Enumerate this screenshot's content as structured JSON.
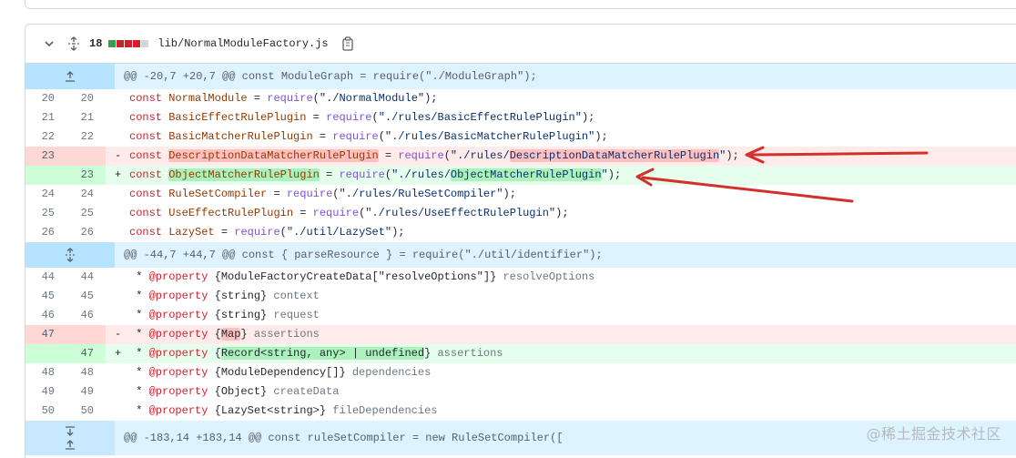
{
  "file": {
    "change_count": "18",
    "stat_colors": [
      "#2da44e",
      "#cf222e",
      "#cf222e",
      "#cf222e",
      "#d0d7de"
    ],
    "path": "lib/NormalModuleFactory.js",
    "icons": {
      "collapse": "chevron-down-icon",
      "expand": "unfold-icon",
      "copy": "copy-icon"
    }
  },
  "hunks": [
    {
      "header": "@@ -20,7 +20,7 @@ const ModuleGraph = require(\"./ModuleGraph\");"
    },
    {
      "header": "@@ -44,7 +44,7 @@ const { parseResource } = require(\"./util/identifier\");"
    },
    {
      "header": "@@ -183,14 +183,14 @@ const ruleSetCompiler = new RuleSetCompiler(["
    }
  ],
  "lines": [
    {
      "old": "20",
      "new": "20",
      "sign": " ",
      "text": "const NormalModule = require(\"./NormalModule\");"
    },
    {
      "old": "21",
      "new": "21",
      "sign": " ",
      "text": "const BasicEffectRulePlugin = require(\"./rules/BasicEffectRulePlugin\");"
    },
    {
      "old": "22",
      "new": "22",
      "sign": " ",
      "text": "const BasicMatcherRulePlugin = require(\"./rules/BasicMatcherRulePlugin\");"
    },
    {
      "old": "23",
      "new": "",
      "sign": "-",
      "text": "const DescriptionDataMatcherRulePlugin = require(\"./rules/DescriptionDataMatcherRulePlugin\");"
    },
    {
      "old": "",
      "new": "23",
      "sign": "+",
      "text": "const ObjectMatcherRulePlugin = require(\"./rules/ObjectMatcherRulePlugin\");"
    },
    {
      "old": "24",
      "new": "24",
      "sign": " ",
      "text": "const RuleSetCompiler = require(\"./rules/RuleSetCompiler\");"
    },
    {
      "old": "25",
      "new": "25",
      "sign": " ",
      "text": "const UseEffectRulePlugin = require(\"./rules/UseEffectRulePlugin\");"
    },
    {
      "old": "26",
      "new": "26",
      "sign": " ",
      "text": "const LazySet = require(\"./util/LazySet\");"
    },
    {
      "old": "44",
      "new": "44",
      "sign": " ",
      "text": " * @property {ModuleFactoryCreateData[\"resolveOptions\"]} resolveOptions"
    },
    {
      "old": "45",
      "new": "45",
      "sign": " ",
      "text": " * @property {string} context"
    },
    {
      "old": "46",
      "new": "46",
      "sign": " ",
      "text": " * @property {string} request"
    },
    {
      "old": "47",
      "new": "",
      "sign": "-",
      "text": " * @property {Map} assertions"
    },
    {
      "old": "",
      "new": "47",
      "sign": "+",
      "text": " * @property {Record<string, any> | undefined} assertions"
    },
    {
      "old": "48",
      "new": "48",
      "sign": " ",
      "text": " * @property {ModuleDependency[]} dependencies"
    },
    {
      "old": "49",
      "new": "49",
      "sign": " ",
      "text": " * @property {Object} createData"
    },
    {
      "old": "50",
      "new": "50",
      "sign": " ",
      "text": " * @property {LazySet<string>} fileDependencies"
    }
  ],
  "code_tokens": {
    "l0": {
      "kw": "const",
      "name": "NormalModule",
      "eq": " = ",
      "fn": "require",
      "p1": "(",
      "str": "\"./NormalModule\"",
      "p2": ");"
    },
    "l1": {
      "kw": "const",
      "name": "BasicEffectRulePlugin",
      "eq": " = ",
      "fn": "require",
      "p1": "(",
      "str": "\"./rules/BasicEffectRulePlugin\"",
      "p2": ");"
    },
    "l2": {
      "kw": "const",
      "name": "BasicMatcherRulePlugin",
      "eq": " = ",
      "fn": "require",
      "p1": "(",
      "str": "\"./rules/BasicMatcherRulePlugin\"",
      "p2": ");"
    },
    "l3": {
      "kw": "const",
      "name": "DescriptionDataMatcherRulePlugin",
      "eq": " = ",
      "fn": "require",
      "p1": "(",
      "str_a": "\"./rules/",
      "str_hl": "DescriptionDataMatcherRulePlugin",
      "str_b": "\"",
      "p2": ");"
    },
    "l4": {
      "kw": "const",
      "name": "ObjectMatcherRulePlugin",
      "eq": " = ",
      "fn": "require",
      "p1": "(",
      "str_a": "\"./rules/",
      "str_hl": "ObjectMatcherRulePlugin",
      "str_b": "\"",
      "p2": ");"
    },
    "l5": {
      "kw": "const",
      "name": "RuleSetCompiler",
      "eq": " = ",
      "fn": "require",
      "p1": "(",
      "str": "\"./rules/RuleSetCompiler\"",
      "p2": ");"
    },
    "l6": {
      "kw": "const",
      "name": "UseEffectRulePlugin",
      "eq": " = ",
      "fn": "require",
      "p1": "(",
      "str": "\"./rules/UseEffectRulePlugin\"",
      "p2": ");"
    },
    "l7": {
      "kw": "const",
      "name": "LazySet",
      "eq": " = ",
      "fn": "require",
      "p1": "(",
      "str": "\"./util/LazySet\"",
      "p2": ");"
    },
    "c0": {
      "star": " * ",
      "tag": "@property",
      "type": "{ModuleFactoryCreateData[\"resolveOptions\"]}",
      "rest": " resolveOptions"
    },
    "c1": {
      "star": " * ",
      "tag": "@property",
      "type": "{string}",
      "rest": " context"
    },
    "c2": {
      "star": " * ",
      "tag": "@property",
      "type": "{string}",
      "rest": " request"
    },
    "c3": {
      "star": " * ",
      "tag": "@property",
      "ob": "{",
      "hl": "Map",
      "cb": "}",
      "rest": " assertions"
    },
    "c4": {
      "star": " * ",
      "tag": "@property",
      "ob": "{",
      "hl": "Record<string, any> | undefined",
      "cb": "}",
      "rest": " assertions"
    },
    "c5": {
      "star": " * ",
      "tag": "@property",
      "type": "{ModuleDependency[]}",
      "rest": " dependencies"
    },
    "c6": {
      "star": " * ",
      "tag": "@property",
      "type": "{Object}",
      "rest": " createData"
    },
    "c7": {
      "star": " * ",
      "tag": "@property",
      "type": "{LazySet<string>}",
      "rest": " fileDependencies"
    }
  },
  "watermark": "@稀土掘金技术社区",
  "annotation_color": "#d0312d"
}
